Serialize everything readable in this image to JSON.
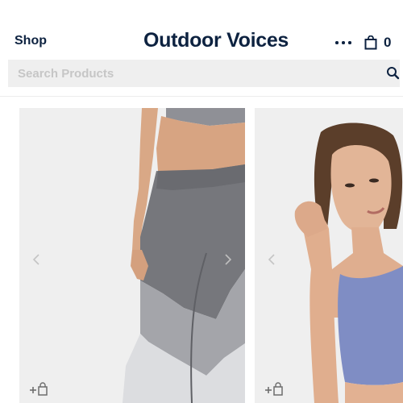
{
  "header": {
    "shop_label": "Shop",
    "brand_title": "Outdoor Voices",
    "more_icon": "more-dots-icon",
    "bag_icon": "shopping-bag-icon",
    "bag_count": "0"
  },
  "search": {
    "placeholder": "Search Products",
    "value": "",
    "icon": "search-icon"
  },
  "products": [
    {
      "image": "model in grey two-tone leggings",
      "prev_icon": "chevron-left-icon",
      "next_icon": "chevron-right-icon",
      "add_icon": "add-to-bag-icon"
    },
    {
      "image": "model in periwinkle crop top",
      "prev_icon": "chevron-left-icon",
      "add_icon": "add-to-bag-icon"
    }
  ],
  "colors": {
    "brand_navy": "#0d2240",
    "search_bg": "#efefef",
    "card_bg": "#efefef",
    "placeholder": "#c6c6c6"
  }
}
